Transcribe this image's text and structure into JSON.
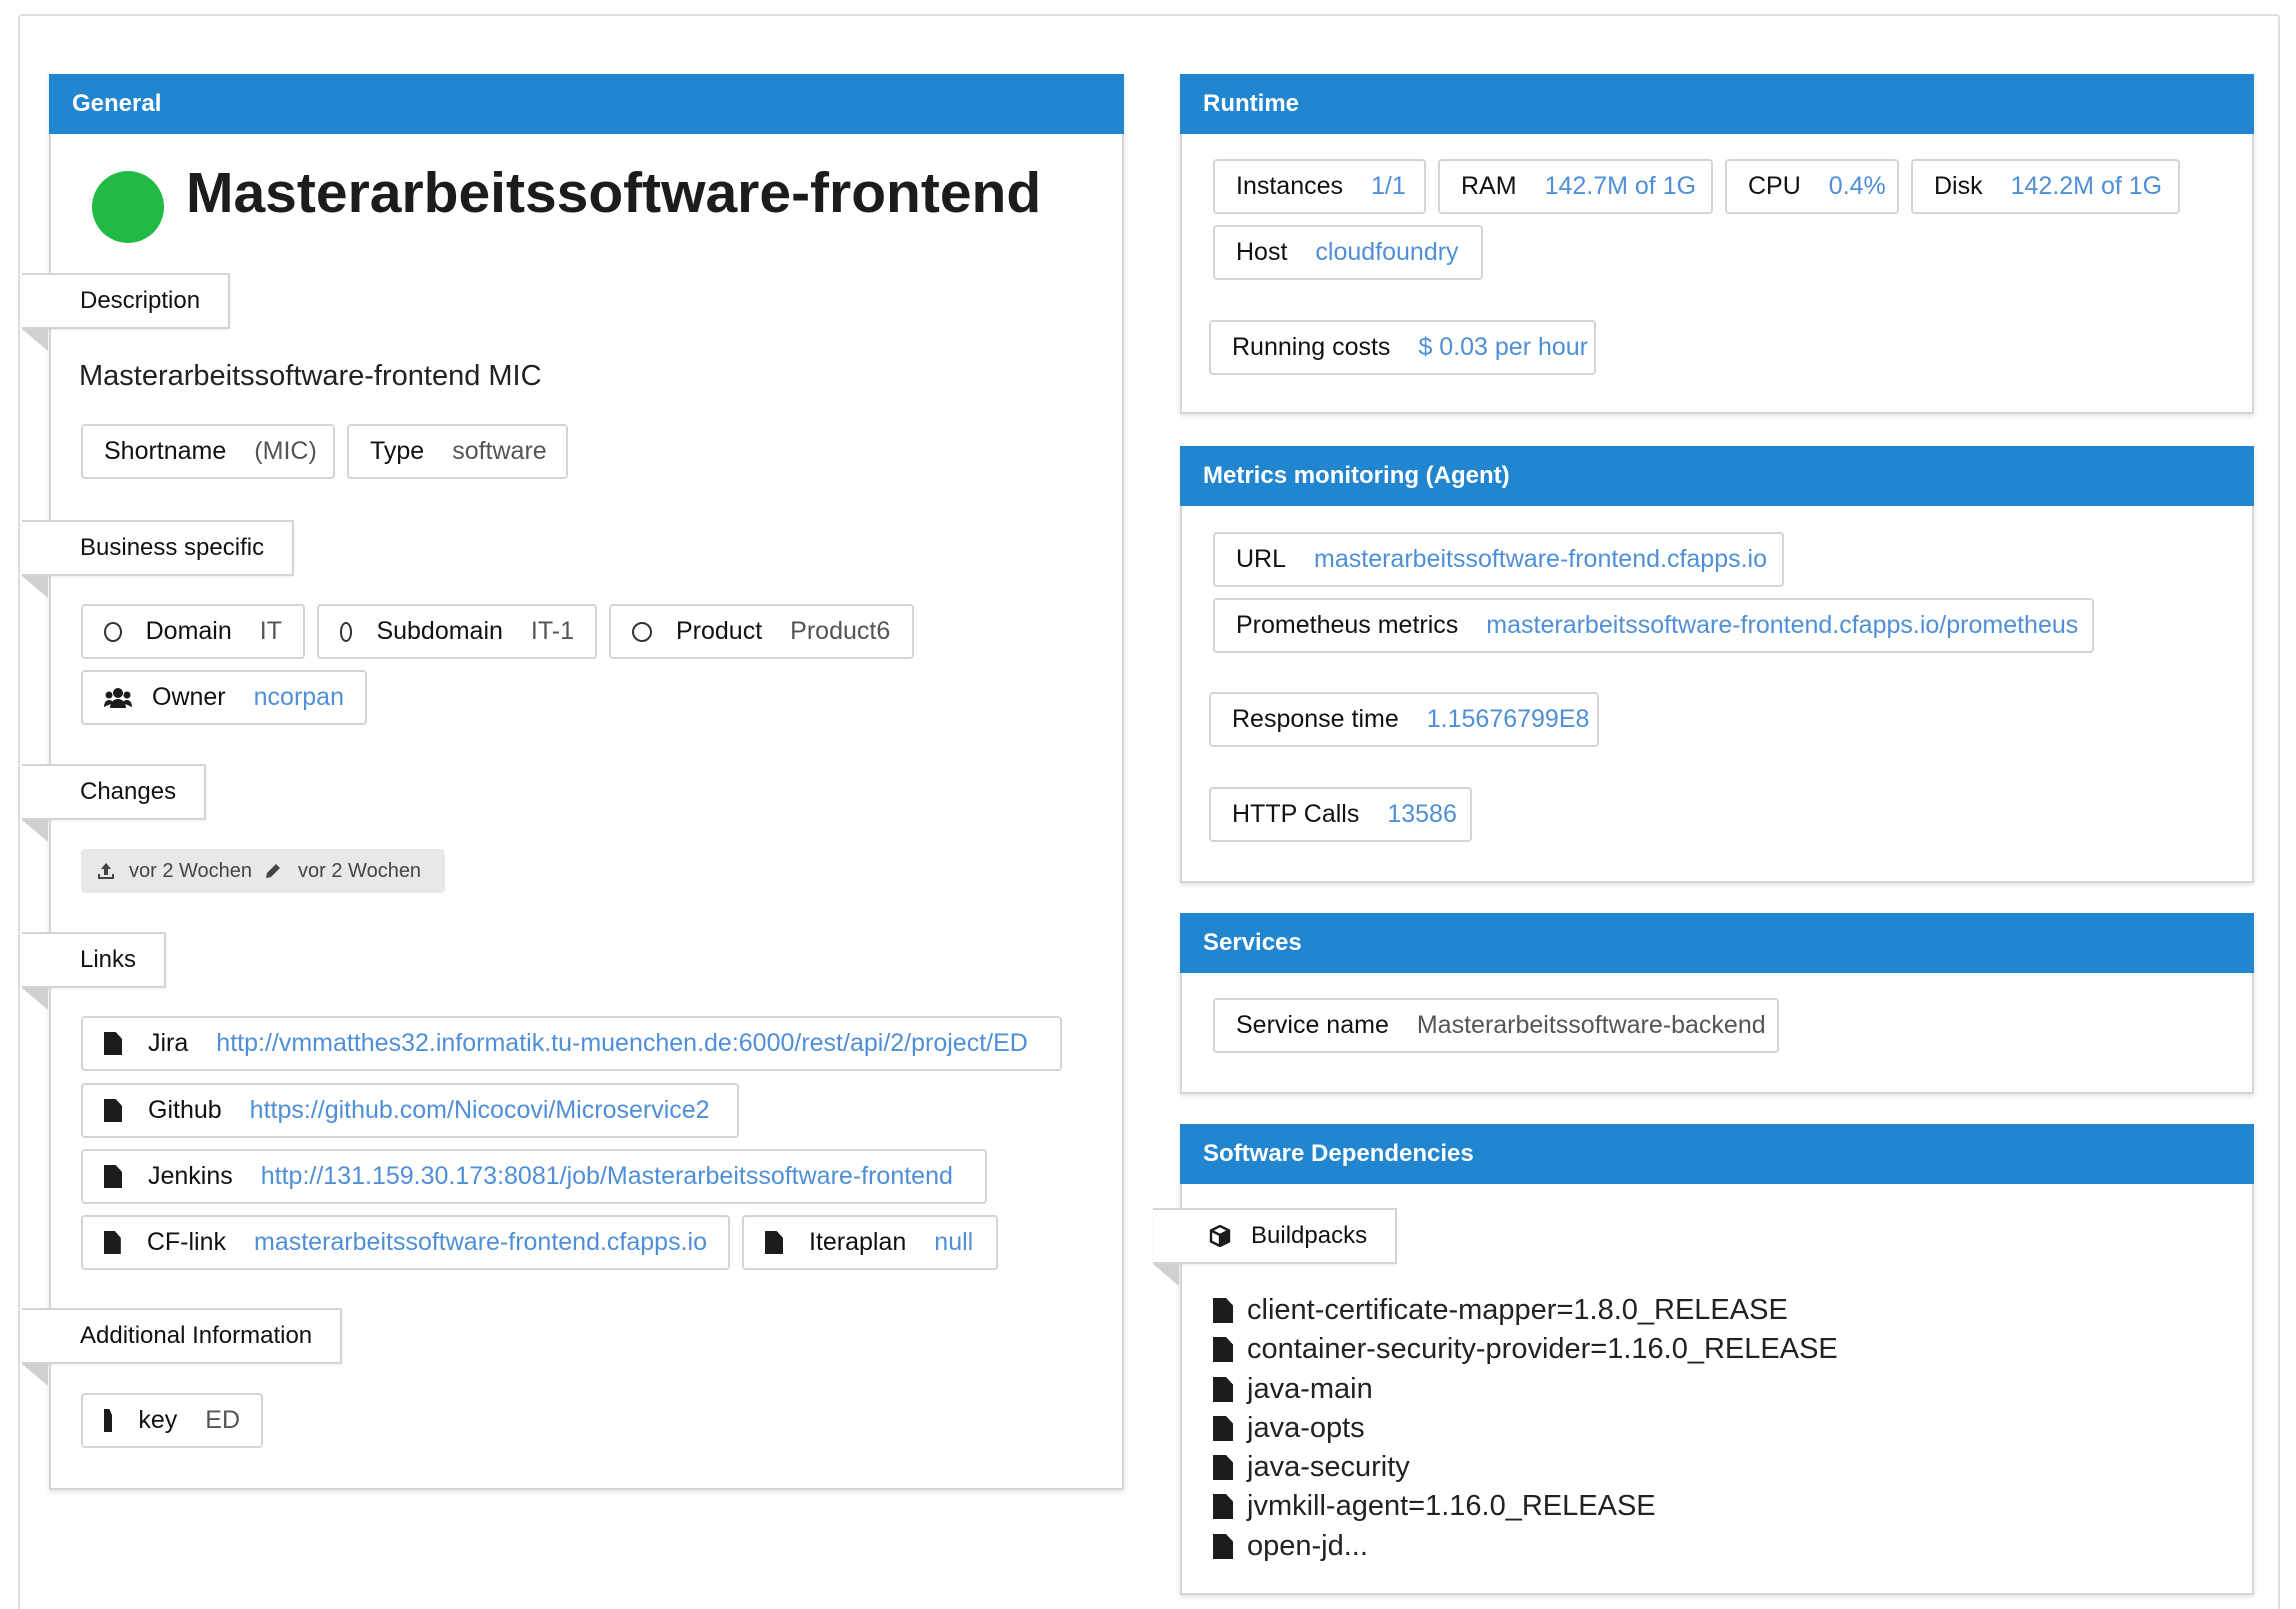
{
  "general": {
    "header": "General",
    "status_color": "#21ba45",
    "app_name": "Masterarbeitssoftware-frontend",
    "description_label": "Description",
    "description_text": "Masterarbeitssoftware-frontend MIC",
    "shortname_key": "Shortname",
    "shortname_val": "(MIC)",
    "type_key": "Type",
    "type_val": "software",
    "business_label": "Business specific",
    "domain_key": "Domain",
    "domain_val": "IT",
    "subdomain_key": "Subdomain",
    "subdomain_val": "IT-1",
    "product_key": "Product",
    "product_val": "Product6",
    "owner_key": "Owner",
    "owner_val": "ncorpan",
    "changes_label": "Changes",
    "created": "vor 2 Wochen",
    "edited": "vor 2 Wochen",
    "links_label": "Links",
    "links": [
      {
        "key": "Jira",
        "val": "http://vmmatthes32.informatik.tu-muenchen.de:6000/rest/api/2/project/ED"
      },
      {
        "key": "Github",
        "val": "https://github.com/Nicocovi/Microservice2"
      },
      {
        "key": "Jenkins",
        "val": "http://131.159.30.173:8081/job/Masterarbeitssoftware-frontend"
      },
      {
        "key": "CF-link",
        "val": "masterarbeitssoftware-frontend.cfapps.io"
      },
      {
        "key": "Iteraplan",
        "val": "null"
      }
    ],
    "additional_label": "Additional Information",
    "add_key": "key",
    "add_val": "ED"
  },
  "runtime": {
    "header": "Runtime",
    "instances_key": "Instances",
    "instances_val": "1/1",
    "ram_key": "RAM",
    "ram_val": "142.7M of 1G",
    "cpu_key": "CPU",
    "cpu_val": "0.4%",
    "disk_key": "Disk",
    "disk_val": "142.2M of 1G",
    "host_key": "Host",
    "host_val": "cloudfoundry",
    "costs_key": "Running costs",
    "costs_val": "$ 0.03 per hour"
  },
  "metrics": {
    "header": "Metrics monitoring (Agent)",
    "url_key": "URL",
    "url_val": "masterarbeitssoftware-frontend.cfapps.io",
    "prom_key": "Prometheus metrics",
    "prom_val": "masterarbeitssoftware-frontend.cfapps.io/prometheus",
    "resp_key": "Response time",
    "resp_val": "1.15676799E8",
    "http_key": "HTTP Calls",
    "http_val": "13586"
  },
  "services": {
    "header": "Services",
    "name_key": "Service name",
    "name_val": "Masterarbeitssoftware-backend"
  },
  "dependencies": {
    "header": "Software Dependencies",
    "buildpacks_label": "Buildpacks",
    "items": [
      "client-certificate-mapper=1.8.0_RELEASE",
      "container-security-provider=1.16.0_RELEASE",
      "java-main",
      "java-opts",
      "java-security",
      "jvmkill-agent=1.16.0_RELEASE",
      "open-jd..."
    ]
  }
}
